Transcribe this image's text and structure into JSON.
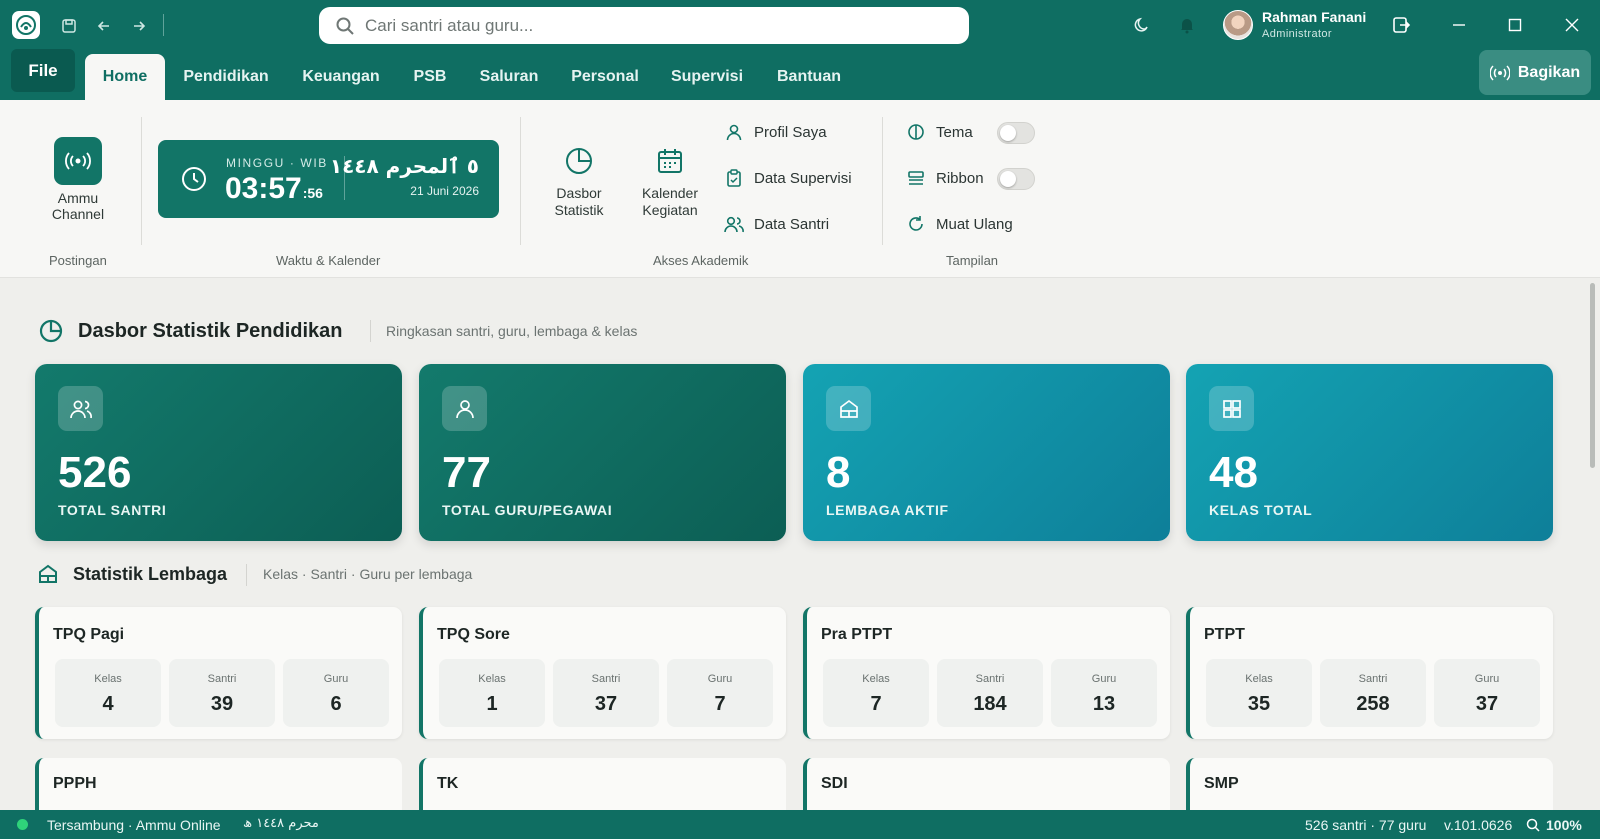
{
  "titlebar": {
    "search_placeholder": "Cari santri atau guru...",
    "user_name": "Rahman Fanani",
    "user_role": "Administrator"
  },
  "tabs": {
    "file": "File",
    "items": [
      "Home",
      "Pendidikan",
      "Keuangan",
      "PSB",
      "Saluran",
      "Personal",
      "Supervisi",
      "Bantuan"
    ],
    "share": "Bagikan"
  },
  "ribbon": {
    "ammu_channel": "Ammu Channel",
    "group_posting": "Postingan",
    "clock": {
      "day": "MINGGU · WIB",
      "time": "03:57",
      "seconds": ":56",
      "hijri": "٥ ٱلمحرم ١٤٤٨",
      "date": "21 Juni 2026"
    },
    "group_time": "Waktu & Kalender",
    "dashboard": "Dasbor Statistik",
    "calendar": "Kalender Kegiatan",
    "profile": "Profil Saya",
    "supervision": "Data Supervisi",
    "students": "Data Santri",
    "group_academic": "Akses Akademik",
    "theme": "Tema",
    "ribbon_toggle": "Ribbon",
    "reload": "Muat Ulang",
    "group_view": "Tampilan"
  },
  "dashboard": {
    "title": "Dasbor Statistik Pendidikan",
    "subtitle": "Ringkasan santri, guru, lembaga & kelas",
    "stats": [
      {
        "value": "526",
        "label": "TOTAL SANTRI",
        "icon": "users-icon"
      },
      {
        "value": "77",
        "label": "TOTAL GURU/PEGAWAI",
        "icon": "user-icon"
      },
      {
        "value": "8",
        "label": "LEMBAGA AKTIF",
        "icon": "institution-icon"
      },
      {
        "value": "48",
        "label": "KELAS TOTAL",
        "icon": "grid-icon"
      }
    ]
  },
  "institutions": {
    "title": "Statistik Lembaga",
    "subtitle": "Kelas · Santri · Guru per lembaga",
    "col_labels": [
      "Kelas",
      "Santri",
      "Guru"
    ],
    "items": [
      {
        "name": "TPQ Pagi",
        "kelas": "4",
        "santri": "39",
        "guru": "6"
      },
      {
        "name": "TPQ Sore",
        "kelas": "1",
        "santri": "37",
        "guru": "7"
      },
      {
        "name": "Pra PTPT",
        "kelas": "7",
        "santri": "184",
        "guru": "13"
      },
      {
        "name": "PTPT",
        "kelas": "35",
        "santri": "258",
        "guru": "37"
      }
    ],
    "more": [
      "PPPH",
      "TK",
      "SDI",
      "SMP"
    ]
  },
  "statusbar": {
    "connection": "Tersambung · Ammu Online",
    "hijri": "محرم ١٤٤٨ ھ",
    "counts": "526 santri · 77 guru",
    "version": "v.101.0626",
    "zoom": "100%"
  },
  "colors": {
    "primary": "#0f6e62",
    "accent_teal": "#14a3b3",
    "online": "#2fd27a"
  }
}
